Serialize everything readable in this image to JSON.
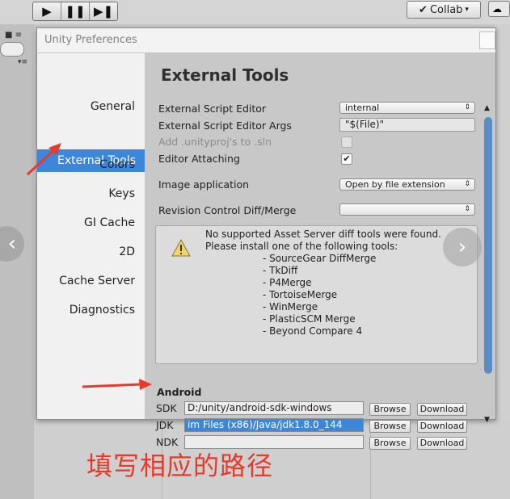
{
  "toolbar": {
    "play_icon": "play-icon",
    "pause_icon": "pause-icon",
    "step_icon": "step-icon",
    "collab_label": "Collab"
  },
  "window": {
    "title": "Unity Preferences"
  },
  "sidebar": {
    "items": [
      {
        "label": "General",
        "selected": false
      },
      {
        "label": "External Tools",
        "selected": true
      },
      {
        "label": "Colors",
        "selected": false
      },
      {
        "label": "Keys",
        "selected": false
      },
      {
        "label": "GI Cache",
        "selected": false
      },
      {
        "label": "2D",
        "selected": false
      },
      {
        "label": "Cache Server",
        "selected": false
      },
      {
        "label": "Diagnostics",
        "selected": false
      }
    ]
  },
  "content": {
    "heading": "External Tools",
    "script_editor_label": "External Script Editor",
    "script_editor_value": "internal",
    "script_args_label": "External Script Editor Args",
    "script_args_value": "\"$(File)\"",
    "add_unityproj_label": "Add .unityproj's to .sln",
    "add_unityproj_checked": false,
    "editor_attaching_label": "Editor Attaching",
    "editor_attaching_checked": true,
    "image_app_label": "Image application",
    "image_app_value": "Open by file extension",
    "revision_label": "Revision Control Diff/Merge",
    "revision_value": "",
    "help": {
      "line1": "No supported Asset Server diff tools were found.",
      "line2": "Please install one of the following tools:",
      "tools": [
        "- SourceGear DiffMerge",
        "- TkDiff",
        "- P4Merge",
        "- TortoiseMerge",
        "- WinMerge",
        "- PlasticSCM Merge",
        "- Beyond Compare 4"
      ]
    },
    "android": {
      "section_label": "Android",
      "sdk_label": "SDK",
      "sdk_value": "D:/unity/android-sdk-windows",
      "jdk_label": "JDK",
      "jdk_value": "im Files (x86)/Java/jdk1.8.0_144",
      "ndk_label": "NDK",
      "ndk_value": "",
      "browse_label": "Browse",
      "download_label": "Download"
    }
  },
  "annotation": {
    "note": "填写相应的路径",
    "color": "#e63a2a"
  },
  "colors": {
    "selection": "#3d86da",
    "scroll_thumb": "#5a8dc6"
  }
}
